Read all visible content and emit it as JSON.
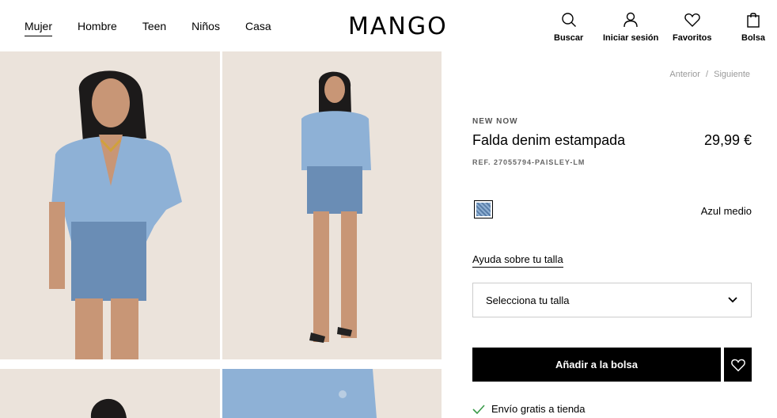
{
  "nav": {
    "items": [
      "Mujer",
      "Hombre",
      "Teen",
      "Niños",
      "Casa"
    ]
  },
  "logo": "MANGO",
  "header_actions": {
    "search": "Buscar",
    "login": "Iniciar sesión",
    "favorites": "Favoritos",
    "bag": "Bolsa"
  },
  "pager": {
    "prev": "Anterior",
    "sep": "/",
    "next": "Siguiente"
  },
  "product": {
    "badge": "NEW NOW",
    "name": "Falda denim estampada",
    "price": "29,99 €",
    "ref": "REF. 27055794-PAISLEY-LM",
    "color_name": "Azul medio",
    "size_help": "Ayuda sobre tu talla",
    "size_select": "Selecciona tu talla",
    "add_to_bag": "Añadir a la bolsa",
    "shipping": "Envío gratis a tienda"
  },
  "colors": {
    "accent": "#000000",
    "background": "#ffffff",
    "check": "#3a9b4a",
    "photo_bg": "#ebe3db",
    "denim": "#7fa3c8"
  }
}
